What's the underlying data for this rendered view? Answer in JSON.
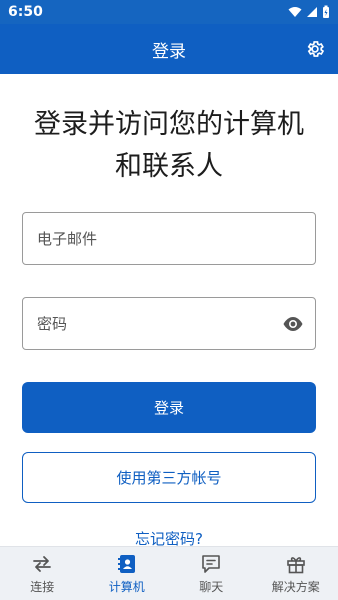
{
  "status_bar": {
    "time": "6:50"
  },
  "app_bar": {
    "title": "登录"
  },
  "heading": "登录并访问您的计算机和联系人",
  "form": {
    "email_placeholder": "电子邮件",
    "password_placeholder": "密码",
    "login_button": "登录",
    "third_party_button": "使用第三方帐号",
    "forgot_password": "忘记密码?"
  },
  "bottom_nav": {
    "items": [
      {
        "label": "连接",
        "icon": "connect-arrows-icon"
      },
      {
        "label": "计算机",
        "icon": "contacts-icon",
        "active": true
      },
      {
        "label": "聊天",
        "icon": "chat-icon"
      },
      {
        "label": "解决方案",
        "icon": "gift-icon"
      }
    ]
  },
  "colors": {
    "primary": "#0f5fc2",
    "status_bar": "#1565c0",
    "nav_bg": "#eef1f5"
  }
}
